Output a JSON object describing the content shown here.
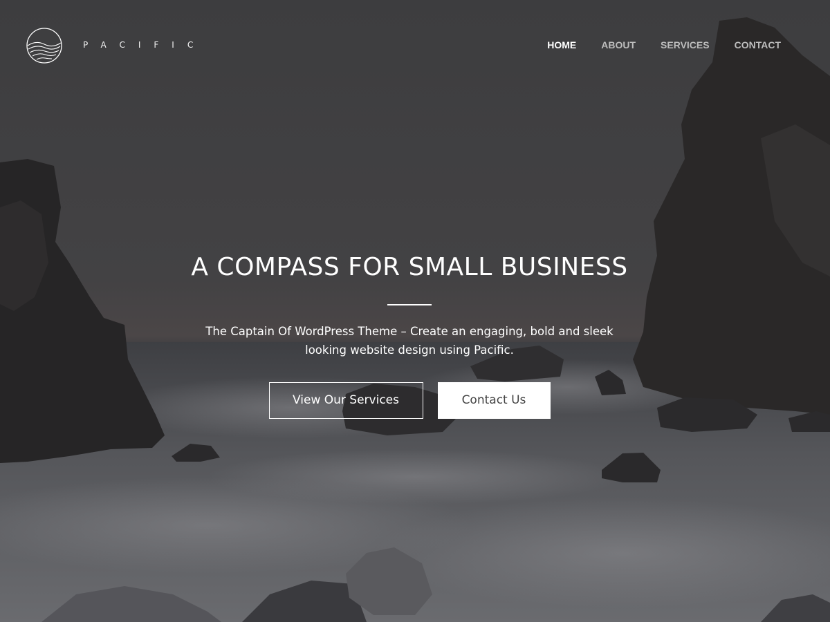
{
  "header": {
    "brand": "PACIFIC",
    "logo_icon": "waves-circle-icon",
    "nav": [
      {
        "label": "HOME",
        "active": true
      },
      {
        "label": "ABOUT",
        "active": false
      },
      {
        "label": "SERVICES",
        "active": false
      },
      {
        "label": "CONTACT",
        "active": false
      }
    ]
  },
  "hero": {
    "title": "A COMPASS FOR SMALL BUSINESS",
    "subtitle": "The Captain Of WordPress Theme – Create an engaging, bold and sleek looking website design using Pacific.",
    "primary_button": "View Our Services",
    "secondary_button": "Contact Us"
  },
  "colors": {
    "overlay": "#3b3b3d",
    "text": "#ffffff",
    "nav_inactive": "#bdbdbd"
  }
}
